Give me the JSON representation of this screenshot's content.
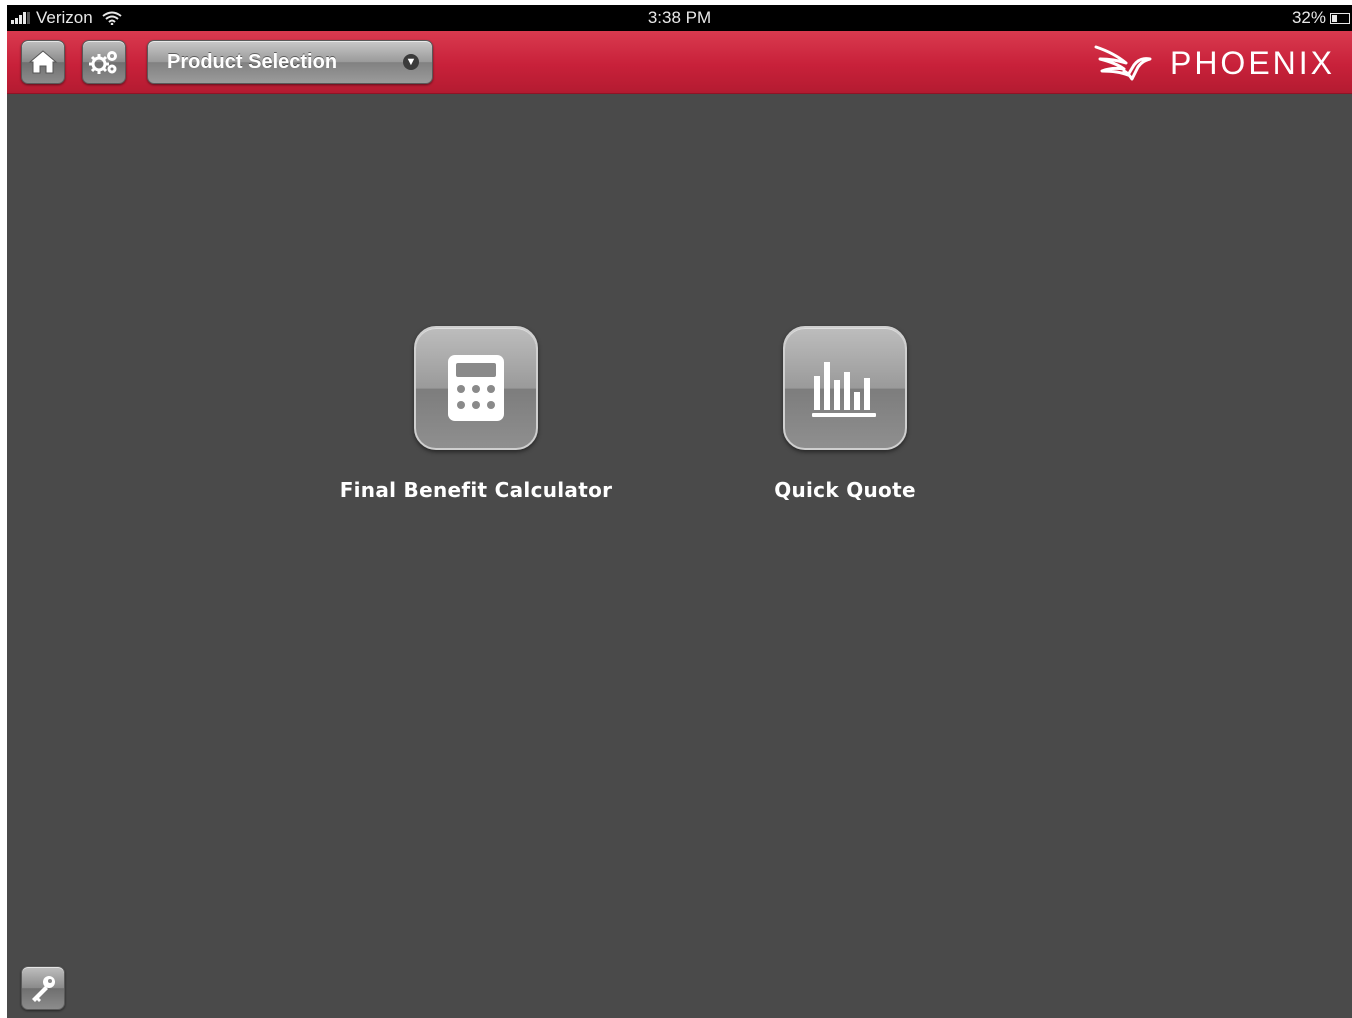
{
  "status_bar": {
    "carrier": "Verizon",
    "time": "3:38 PM",
    "battery": "32%"
  },
  "header": {
    "home_icon": "home-icon",
    "settings_icon": "gears-icon",
    "product_selector_label": "Product Selection",
    "brand": "PHOENIX",
    "accent_color": "#c8213a"
  },
  "main": {
    "tiles": [
      {
        "label": "Final Benefit Calculator",
        "icon": "calculator-icon"
      },
      {
        "label": "Quick Quote",
        "icon": "bar-chart-icon"
      }
    ]
  },
  "footer": {
    "key_icon": "key-icon"
  }
}
